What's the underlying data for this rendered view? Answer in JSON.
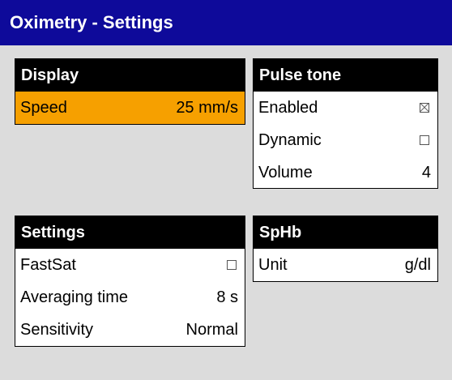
{
  "window": {
    "title": "Oximetry - Settings"
  },
  "colors": {
    "title_bar": "#0e0a9a",
    "selection": "#f6a000",
    "background": "#dcdcdc",
    "panel_header": "#000000"
  },
  "display": {
    "header": "Display",
    "speed_label": "Speed",
    "speed_value": "25 mm/s"
  },
  "pulse_tone": {
    "header": "Pulse tone",
    "enabled_label": "Enabled",
    "enabled_checked": true,
    "dynamic_label": "Dynamic",
    "dynamic_checked": false,
    "volume_label": "Volume",
    "volume_value": "4"
  },
  "settings": {
    "header": "Settings",
    "fastsat_label": "FastSat",
    "fastsat_checked": false,
    "averaging_label": "Averaging time",
    "averaging_value": "8 s",
    "sensitivity_label": "Sensitivity",
    "sensitivity_value": "Normal"
  },
  "sphb": {
    "header": "SpHb",
    "unit_label": "Unit",
    "unit_value": "g/dl"
  }
}
